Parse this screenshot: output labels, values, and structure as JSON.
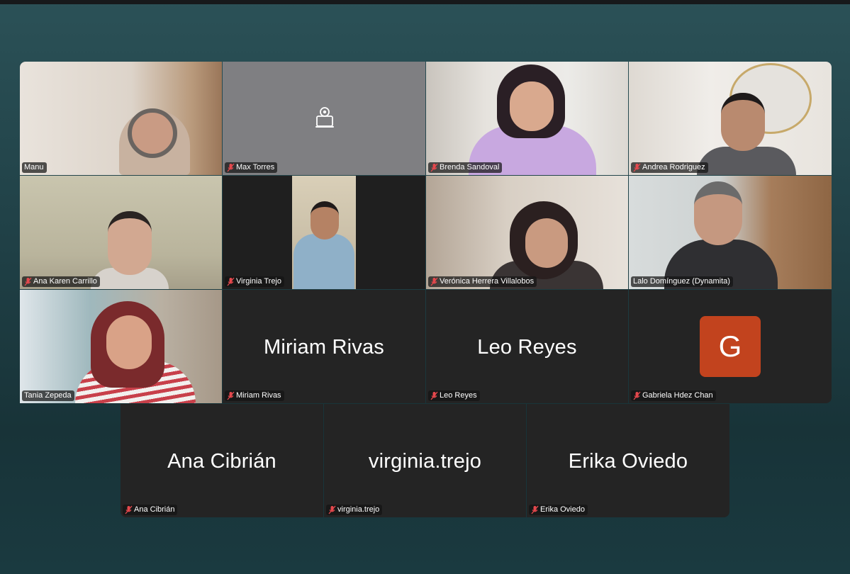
{
  "meeting": {
    "participants": [
      {
        "name": "Manu",
        "muted": false
      },
      {
        "name": "Max Torres",
        "muted": true,
        "video": "off-camera-icon"
      },
      {
        "name": "Brenda Sandoval",
        "muted": true
      },
      {
        "name": "Andrea Rodriguez",
        "muted": true
      },
      {
        "name": "Ana Karen Carrillo",
        "muted": true
      },
      {
        "name": "Virginia Trejo",
        "muted": true
      },
      {
        "name": "Verónica Herrera Villalobos",
        "muted": true
      },
      {
        "name": "Lalo Domínguez (Dynamita)",
        "muted": false
      },
      {
        "name": "Tania Zepeda",
        "muted": false,
        "active_speaker": true
      },
      {
        "name": "Miriam Rivas",
        "muted": true,
        "display": "Miriam Rivas"
      },
      {
        "name": "Leo Reyes",
        "muted": true,
        "display": "Leo Reyes"
      },
      {
        "name": "Gabriela Hdez Chan",
        "muted": true,
        "avatar_letter": "G",
        "avatar_color": "#c2431e"
      },
      {
        "name": "Ana Cibrián",
        "muted": true,
        "display": "Ana Cibrián"
      },
      {
        "name": "virginia.trejo",
        "muted": true,
        "display": "virginia.trejo"
      },
      {
        "name": "Erika Oviedo",
        "muted": true,
        "display": "Erika Oviedo"
      }
    ]
  },
  "colors": {
    "tile_bg": "#242424",
    "active_speaker_border": "#5fd35f",
    "muted_icon": "#e5484d"
  }
}
